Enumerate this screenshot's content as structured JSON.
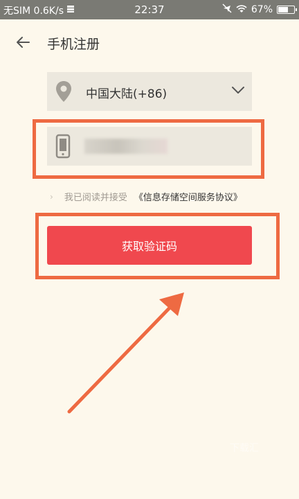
{
  "status_bar": {
    "carrier": "无SIM 0.6K/s",
    "time": "22:37",
    "battery": "67%"
  },
  "header": {
    "title": "手机注册",
    "back_icon": "arrow-left-icon"
  },
  "region": {
    "label": "中国大陆(+86)",
    "icon": "location-pin-icon",
    "chevron_icon": "chevron-down-icon"
  },
  "phone": {
    "icon": "mobile-phone-icon"
  },
  "agreement": {
    "prefix": "我已阅读并接受",
    "link": "《信息存储空间服务协议》"
  },
  "get_code_button": {
    "label": "获取验证码"
  },
  "watermark": {
    "text": "下载汇"
  },
  "colors": {
    "background": "#fdf8ec",
    "primary_button": "#f0484e",
    "annotation": "#ee6a42",
    "field_bg": "#ece8de"
  }
}
